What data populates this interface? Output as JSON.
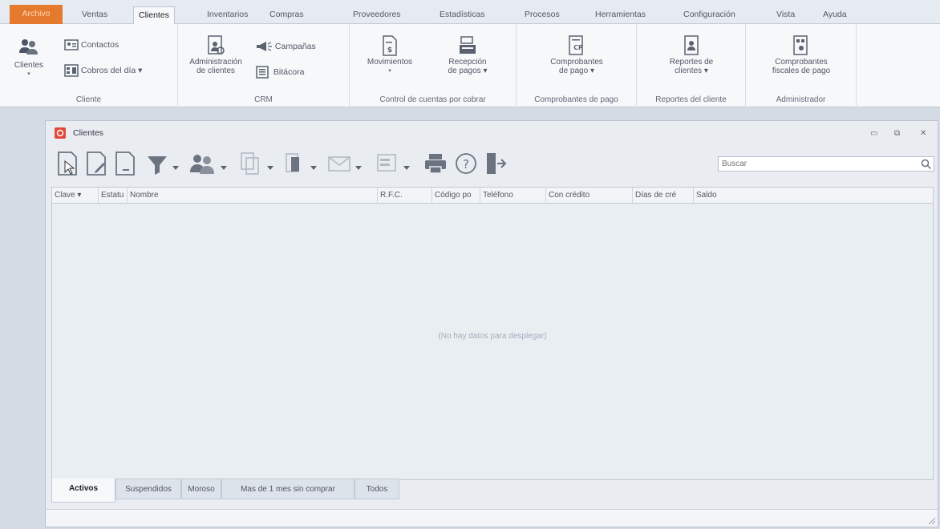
{
  "menu": {
    "file": "Archivo",
    "tabs": [
      "Ventas",
      "Clientes",
      "Inventarios",
      "Compras",
      "Proveedores",
      "Estadísticas",
      "Procesos",
      "Herramientas",
      "Configuración",
      "Vista",
      "Ayuda"
    ],
    "active": "Clientes"
  },
  "ribbon": {
    "cliente": {
      "label": "Cliente",
      "clientes": "Clientes",
      "contactos": "Contactos",
      "cobros": "Cobros del día ▾"
    },
    "crm": {
      "label": "CRM",
      "admin_line1": "Administración",
      "admin_line2": "de clientes",
      "campanas": "Campañas",
      "bitacora": "Bitácora"
    },
    "cxc": {
      "label": "Control de cuentas por cobrar",
      "movimientos": "Movimientos",
      "recepcion_line1": "Recepción",
      "recepcion_line2": "de pagos ▾"
    },
    "cp": {
      "label": "Comprobantes de pago",
      "line1": "Comprobantes",
      "line2": "de pago ▾"
    },
    "reportes": {
      "label": "Reportes del cliente",
      "line1": "Reportes de",
      "line2": "clientes ▾"
    },
    "admin": {
      "label": "Administrador",
      "line1": "Comprobantes",
      "line2": "fiscales de pago"
    }
  },
  "window": {
    "title": "Clientes",
    "search_placeholder": "Buscar"
  },
  "grid": {
    "columns": [
      "Clave ▾",
      "Estatu",
      "Nombre",
      "R.F.C.",
      "Código po",
      "Teléfono",
      "Con crédito",
      "Días de cré",
      "Saldo"
    ],
    "empty_text": "(No hay datos para desplegar)"
  },
  "bottom_tabs": [
    "Activos",
    "Suspendidos",
    "Moroso",
    "Mas de 1 mes sin comprar",
    "Todos"
  ],
  "colors": {
    "file_tab": "#e57a2e",
    "window_icon": "#e0483b",
    "toolbar_icon": "#6b7380"
  }
}
